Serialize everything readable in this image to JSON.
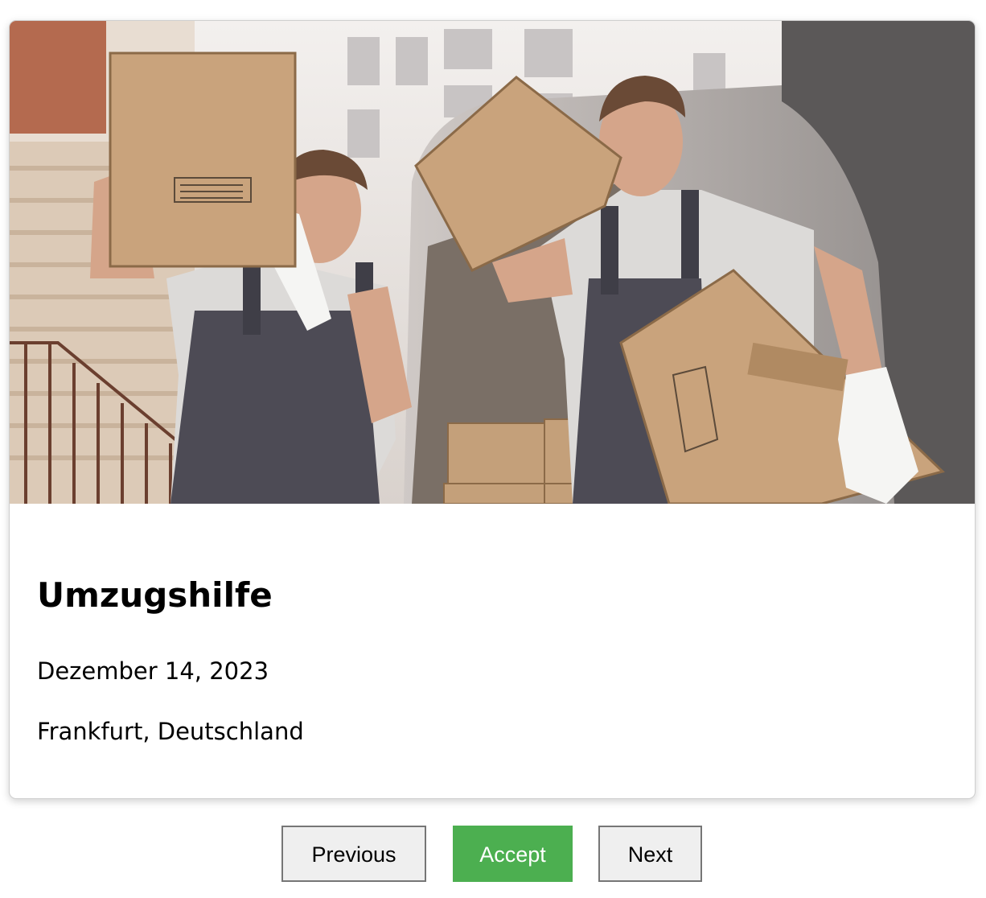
{
  "card": {
    "image_alt": "Two movers carrying cardboard boxes from a van",
    "title": "Umzugshilfe",
    "date": "Dezember 14, 2023",
    "location": "Frankfurt, Deutschland"
  },
  "actions": {
    "previous_label": "Previous",
    "accept_label": "Accept",
    "next_label": "Next"
  },
  "colors": {
    "accept_bg": "#4caf50",
    "button_bg": "#efefef",
    "button_border": "#767676"
  }
}
